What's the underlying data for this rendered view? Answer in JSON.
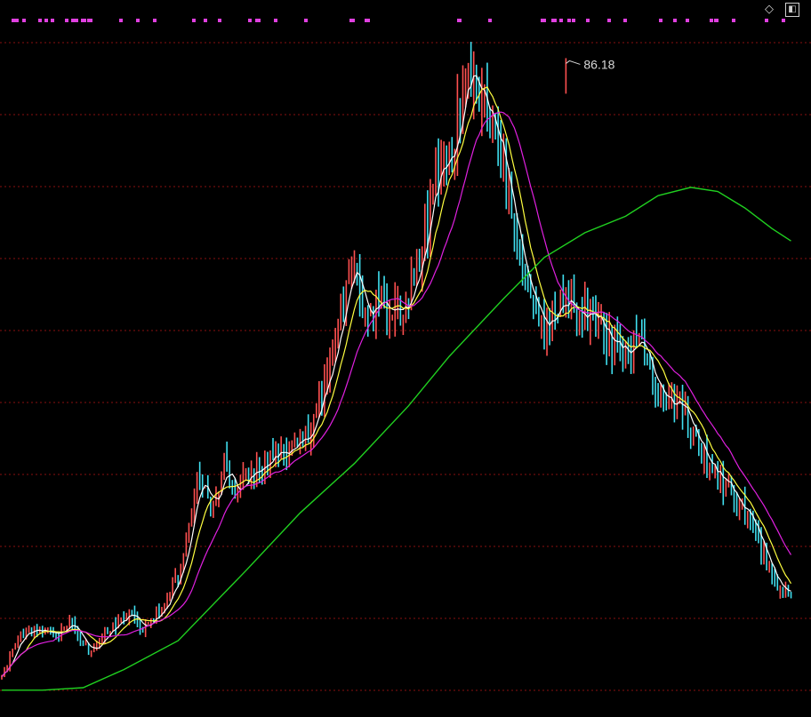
{
  "toolbar": {
    "diamond_icon": "diamond-icon",
    "panel_icon": "panel-toggle-icon"
  },
  "colors": {
    "background": "#000000",
    "grid": "#8a1010",
    "up": "#ff5050",
    "down": "#40e0f0",
    "ma_short": "#ffffff",
    "ma_mid": "#ffff40",
    "ma_long": "#e020e0",
    "ma_slow": "#20d020",
    "signal": "#e040e0",
    "peak_label": "#d8d8d8"
  },
  "chart_data": {
    "type": "candlestick",
    "title": "",
    "xlabel": "",
    "ylabel": "",
    "grid": "horizontal-dashed",
    "ylim": [
      7,
      90
    ],
    "peak_label": "86.18",
    "peak_value": 86.18,
    "signal_dot_count": 50,
    "close_path": [
      [
        0,
        11
      ],
      [
        6,
        16
      ],
      [
        14,
        17
      ],
      [
        20,
        16
      ],
      [
        25,
        17.5
      ],
      [
        33,
        14
      ],
      [
        40,
        17
      ],
      [
        47,
        19
      ],
      [
        52,
        17
      ],
      [
        58,
        19
      ],
      [
        66,
        24
      ],
      [
        72,
        36
      ],
      [
        78,
        32
      ],
      [
        82,
        37
      ],
      [
        86,
        33
      ],
      [
        93,
        36
      ],
      [
        100,
        38
      ],
      [
        106,
        39
      ],
      [
        113,
        40
      ],
      [
        119,
        47
      ],
      [
        124,
        54
      ],
      [
        130,
        61
      ],
      [
        134,
        55
      ],
      [
        140,
        57
      ],
      [
        149,
        56
      ],
      [
        160,
        71
      ],
      [
        166,
        76
      ],
      [
        173,
        84
      ],
      [
        179,
        79
      ],
      [
        186,
        71
      ],
      [
        193,
        60
      ],
      [
        200,
        53
      ],
      [
        208,
        57
      ],
      [
        216,
        55
      ],
      [
        226,
        51
      ],
      [
        236,
        52
      ],
      [
        243,
        45
      ],
      [
        250,
        44
      ],
      [
        254,
        41
      ],
      [
        262,
        36
      ],
      [
        268,
        34
      ],
      [
        276,
        30
      ],
      [
        283,
        24
      ],
      [
        286,
        22
      ],
      [
        291,
        21
      ]
    ],
    "ohlc_seed": 20240917,
    "moving_averages": [
      {
        "period": 5,
        "color": "#ffffff"
      },
      {
        "period": 10,
        "color": "#ffff40"
      },
      {
        "period": 20,
        "color": "#e020e0"
      }
    ],
    "slow_line": [
      [
        0,
        9.5
      ],
      [
        15,
        9.5
      ],
      [
        30,
        9.8
      ],
      [
        45,
        12
      ],
      [
        65,
        15.5
      ],
      [
        90,
        24
      ],
      [
        110,
        31
      ],
      [
        130,
        37
      ],
      [
        150,
        44
      ],
      [
        165,
        50
      ],
      [
        185,
        57
      ],
      [
        200,
        62
      ],
      [
        215,
        65
      ],
      [
        230,
        67
      ],
      [
        242,
        69.5
      ],
      [
        254,
        70.5
      ],
      [
        264,
        70
      ],
      [
        274,
        68
      ],
      [
        284,
        65.5
      ],
      [
        291,
        64
      ]
    ]
  }
}
